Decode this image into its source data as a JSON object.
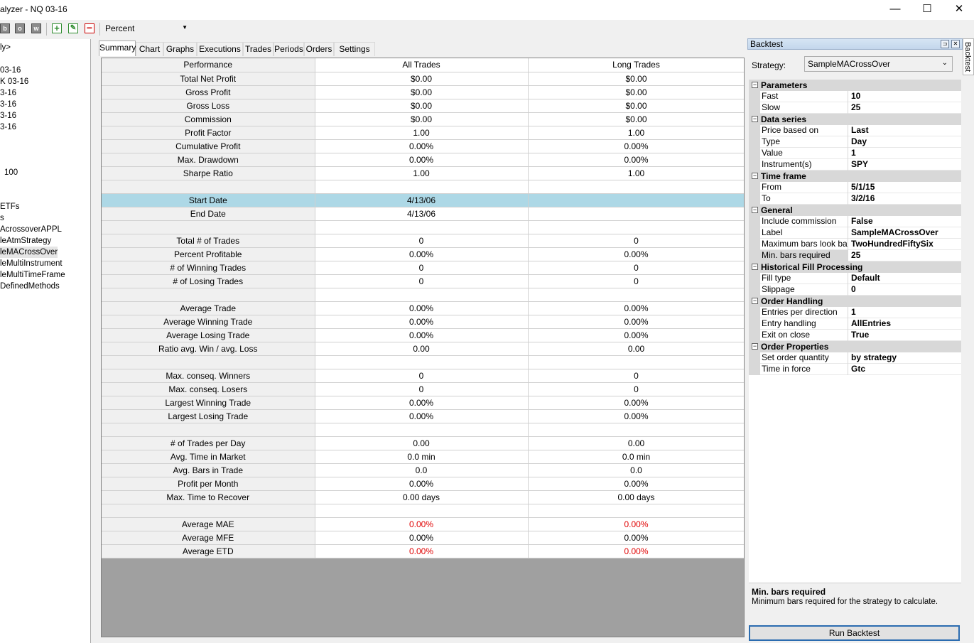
{
  "window": {
    "title": "alyzer - NQ 03-16",
    "controls": {
      "minimize": "—",
      "maximize": "☐",
      "close": "✕"
    }
  },
  "toolbar": {
    "icons": [
      {
        "glyph": "b"
      },
      {
        "glyph": "o"
      },
      {
        "glyph": "w"
      },
      {
        "glyph": "+"
      },
      {
        "glyph": "✎"
      },
      {
        "glyph": "−"
      }
    ],
    "display_mode": "Percent"
  },
  "left_panel": {
    "items": [
      "ly>",
      "03-16",
      "K 03-16",
      "3-16",
      "3-16",
      "3-16",
      "3-16",
      "100",
      "ETFs",
      "s",
      "AcrossoverAPPL",
      "leAtmStrategy",
      "leMACrossOver",
      "leMultiInstrument",
      "leMultiTimeFrame",
      "DefinedMethods"
    ]
  },
  "tabs": [
    "Summary",
    "Chart",
    "Graphs",
    "Executions",
    "Trades",
    "Periods",
    "Orders",
    "Settings"
  ],
  "grid": {
    "headers": [
      "Performance",
      "All Trades",
      "Long Trades"
    ],
    "rows": [
      [
        "Total Net Profit",
        "$0.00",
        "$0.00"
      ],
      [
        "Gross Profit",
        "$0.00",
        "$0.00"
      ],
      [
        "Gross Loss",
        "$0.00",
        "$0.00"
      ],
      [
        "Commission",
        "$0.00",
        "$0.00"
      ],
      [
        "Profit Factor",
        "1.00",
        "1.00"
      ],
      [
        "Cumulative Profit",
        "0.00%",
        "0.00%"
      ],
      [
        "Max. Drawdown",
        "0.00%",
        "0.00%"
      ],
      [
        "Sharpe Ratio",
        "1.00",
        "1.00"
      ],
      [
        "",
        "",
        ""
      ],
      [
        "Start Date",
        "4/13/06",
        ""
      ],
      [
        "End Date",
        "4/13/06",
        ""
      ],
      [
        "",
        "",
        ""
      ],
      [
        "Total # of Trades",
        "0",
        "0"
      ],
      [
        "Percent Profitable",
        "0.00%",
        "0.00%"
      ],
      [
        "# of Winning Trades",
        "0",
        "0"
      ],
      [
        "# of Losing Trades",
        "0",
        "0"
      ],
      [
        "",
        "",
        ""
      ],
      [
        "Average Trade",
        "0.00%",
        "0.00%"
      ],
      [
        "Average Winning Trade",
        "0.00%",
        "0.00%"
      ],
      [
        "Average Losing Trade",
        "0.00%",
        "0.00%"
      ],
      [
        "Ratio avg. Win / avg. Loss",
        "0.00",
        "0.00"
      ],
      [
        "",
        "",
        ""
      ],
      [
        "Max. conseq. Winners",
        "0",
        "0"
      ],
      [
        "Max. conseq. Losers",
        "0",
        "0"
      ],
      [
        "Largest Winning Trade",
        "0.00%",
        "0.00%"
      ],
      [
        "Largest Losing Trade",
        "0.00%",
        "0.00%"
      ],
      [
        "",
        "",
        ""
      ],
      [
        "# of Trades per Day",
        "0.00",
        "0.00"
      ],
      [
        "Avg. Time in Market",
        "0.0 min",
        "0.0 min"
      ],
      [
        "Avg. Bars in Trade",
        "0.0",
        "0.0"
      ],
      [
        "Profit per Month",
        "0.00%",
        "0.00%"
      ],
      [
        "Max. Time to Recover",
        "0.00 days",
        "0.00 days"
      ],
      [
        "",
        "",
        ""
      ],
      [
        "Average MAE",
        "0.00%",
        "0.00%"
      ],
      [
        "Average MFE",
        "0.00%",
        "0.00%"
      ],
      [
        "Average ETD",
        "0.00%",
        "0.00%"
      ]
    ],
    "highlight_row": 9,
    "negative_rows": [
      33,
      35
    ],
    "negative_color": "#e00000",
    "highlight_color": "#add8e6"
  },
  "backtest": {
    "header": "Backtest",
    "strategy_label": "Strategy:",
    "strategy_value": "SampleMACrossOver",
    "categories": [
      {
        "name": "Parameters",
        "props": [
          [
            "Fast",
            "10"
          ],
          [
            "Slow",
            "25"
          ]
        ]
      },
      {
        "name": "Data series",
        "props": [
          [
            "Price based on",
            "Last"
          ],
          [
            "Type",
            "Day"
          ],
          [
            "Value",
            "1"
          ],
          [
            "Instrument(s)",
            "SPY"
          ]
        ]
      },
      {
        "name": "Time frame",
        "props": [
          [
            "From",
            "5/1/15"
          ],
          [
            "To",
            "3/2/16"
          ]
        ]
      },
      {
        "name": "General",
        "props": [
          [
            "Include commission",
            "False"
          ],
          [
            "Label",
            "SampleMACrossOver"
          ],
          [
            "Maximum bars look back",
            "TwoHundredFiftySix"
          ],
          [
            "Min. bars required",
            "25"
          ]
        ]
      },
      {
        "name": "Historical Fill Processing",
        "props": [
          [
            "Fill type",
            "Default"
          ],
          [
            "Slippage",
            "0"
          ]
        ]
      },
      {
        "name": "Order Handling",
        "props": [
          [
            "Entries per direction",
            "1"
          ],
          [
            "Entry handling",
            "AllEntries"
          ],
          [
            "Exit on close",
            "True"
          ]
        ]
      },
      {
        "name": "Order Properties",
        "props": [
          [
            "Set order quantity",
            "by strategy"
          ],
          [
            "Time in force",
            "Gtc"
          ]
        ]
      }
    ],
    "selected_property": "Min. bars required",
    "description_title": "Min. bars required",
    "description_text": "Minimum bars required for the strategy to calculate.",
    "run_button": "Run Backtest",
    "side_tab": "Backtest"
  }
}
